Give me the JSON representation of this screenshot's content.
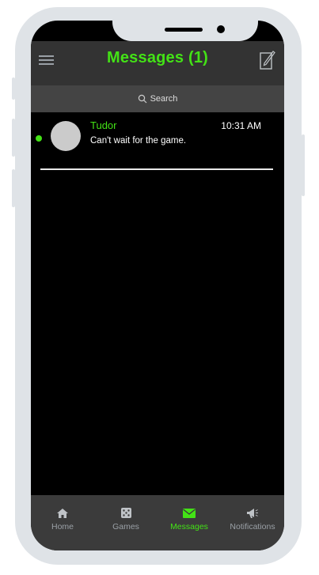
{
  "header": {
    "title": "Messages (1)"
  },
  "search": {
    "label": "Search"
  },
  "messages": [
    {
      "name": "Tudor",
      "time": "10:31 AM",
      "preview": "Can't wait for the game.",
      "unread": true
    }
  ],
  "tabs": [
    {
      "label": "Home",
      "icon": "home-icon",
      "active": false
    },
    {
      "label": "Games",
      "icon": "dice-icon",
      "active": false
    },
    {
      "label": "Messages",
      "icon": "envelope-icon",
      "active": true
    },
    {
      "label": "Notifications",
      "icon": "megaphone-icon",
      "active": false
    }
  ],
  "colors": {
    "accent": "#43e216",
    "header_bg": "#333333",
    "search_bg": "#444444",
    "tabbar_bg": "#3b3b3b"
  }
}
